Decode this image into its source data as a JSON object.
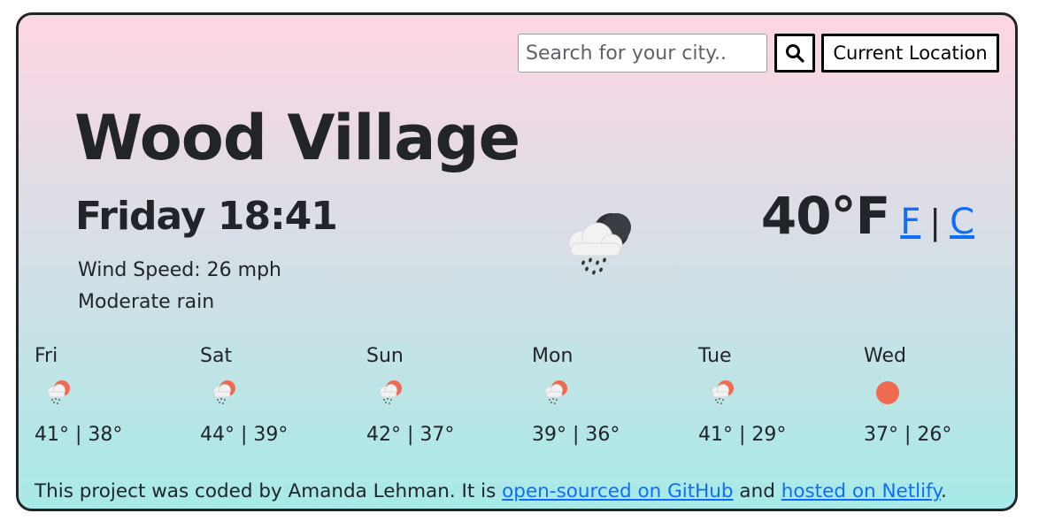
{
  "search": {
    "placeholder": "Search for your city..",
    "search_icon": "search-icon",
    "location_label": "Current Location"
  },
  "current": {
    "city": "Wood Village",
    "datetime": "Friday 18:41",
    "wind": "Wind Speed: 26 mph",
    "description": "Moderate rain",
    "icon": "rain-cloud-night-icon",
    "temperature": "40°F",
    "unit_f": "F",
    "unit_sep": "|",
    "unit_c": "C"
  },
  "forecast": [
    {
      "day": "Fri",
      "temps": "41° | 38°",
      "icon": "rain-sun-icon"
    },
    {
      "day": "Sat",
      "temps": "44° | 39°",
      "icon": "rain-sun-icon"
    },
    {
      "day": "Sun",
      "temps": "42° | 37°",
      "icon": "rain-sun-icon"
    },
    {
      "day": "Mon",
      "temps": "39° | 36°",
      "icon": "rain-sun-icon"
    },
    {
      "day": "Tue",
      "temps": "41° | 29°",
      "icon": "rain-sun-icon"
    },
    {
      "day": "Wed",
      "temps": "37° | 26°",
      "icon": "sun-icon"
    }
  ],
  "footer": {
    "text_before": "This project was coded by Amanda Lehman. It is ",
    "link_github": "open-sourced on GitHub",
    "text_middle": " and ",
    "link_netlify": "hosted on Netlify",
    "text_after": "."
  },
  "colors": {
    "gradient_top": "#fdd6e3",
    "gradient_bottom": "#a7eae7",
    "link": "#0d6efd",
    "sun": "#ef6a50",
    "text": "#212529"
  }
}
